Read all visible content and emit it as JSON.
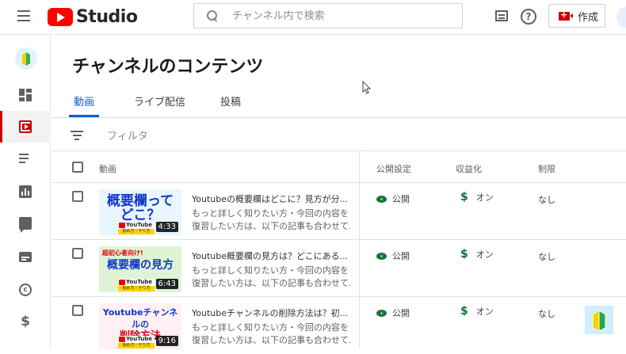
{
  "header": {
    "logo_text": "Studio",
    "search_placeholder": "チャンネル内で検索",
    "create_label": "作成"
  },
  "page": {
    "title": "チャンネルのコンテンツ",
    "tabs": [
      {
        "label": "動画",
        "active": true
      },
      {
        "label": "ライブ配信",
        "active": false
      },
      {
        "label": "投稿",
        "active": false
      }
    ],
    "filter_placeholder": "フィルタ"
  },
  "table": {
    "headers": {
      "video": "動画",
      "visibility": "公開設定",
      "monetization": "収益化",
      "restrictions": "制限"
    },
    "rows": [
      {
        "thumb_top": "",
        "thumb_title_1": "概要欄って",
        "thumb_title_2": "どこ？",
        "thumb_brand": "YouTube",
        "thumb_sub": "始め方・やり方",
        "thumb_color": "#e9f6ff",
        "duration": "4:33",
        "title": "Youtubeの概要欄はどこに？見方が分...",
        "desc_1": "もっと詳しく知りたい方・今回の内容を",
        "desc_2": "復習したい方は、以下の記事も合わせて...",
        "visibility": "公開",
        "monetization": "オン",
        "restrictions": "なし"
      },
      {
        "thumb_top": "超初心者向け!",
        "thumb_title_1": "概要欄の見方",
        "thumb_title_2": "",
        "thumb_brand": "YouTube",
        "thumb_sub": "始め方・やり方",
        "thumb_color": "#dff3d6",
        "duration": "6:43",
        "title": "Youtube概要欄の見方は？どこにある...",
        "desc_1": "もっと詳しく知りたい方・今回の内容を",
        "desc_2": "復習したい方は、以下の記事も合わせて...",
        "visibility": "公開",
        "monetization": "オン",
        "restrictions": "なし"
      },
      {
        "thumb_top": "",
        "thumb_title_1": "Youtubeチャンネルの",
        "thumb_title_2": "削除方法",
        "thumb_brand": "YouTube",
        "thumb_sub": "始め方・やり方",
        "thumb_color": "#fff0f4",
        "duration": "9:16",
        "title": "Youtubeチャンネルの削除方法は？初...",
        "desc_1": "もっと詳しく知りたい方・今回の内容を",
        "desc_2": "復習したい方は、以下の記事も合わせて...",
        "visibility": "公開",
        "monetization": "オン",
        "restrictions": "なし"
      }
    ]
  },
  "icons": {
    "menu": "hamburger-icon",
    "search": "search-icon",
    "feedback": "feedback-icon",
    "help": "help-icon",
    "create": "video-camera-plus-icon",
    "filter": "filter-icon",
    "visibility": "eye-icon",
    "monetization": "dollar-icon"
  },
  "colors": {
    "accent": "#065fd4",
    "brand_red": "#ff0000",
    "active_red": "#cc0000",
    "public_green": "#137333"
  }
}
